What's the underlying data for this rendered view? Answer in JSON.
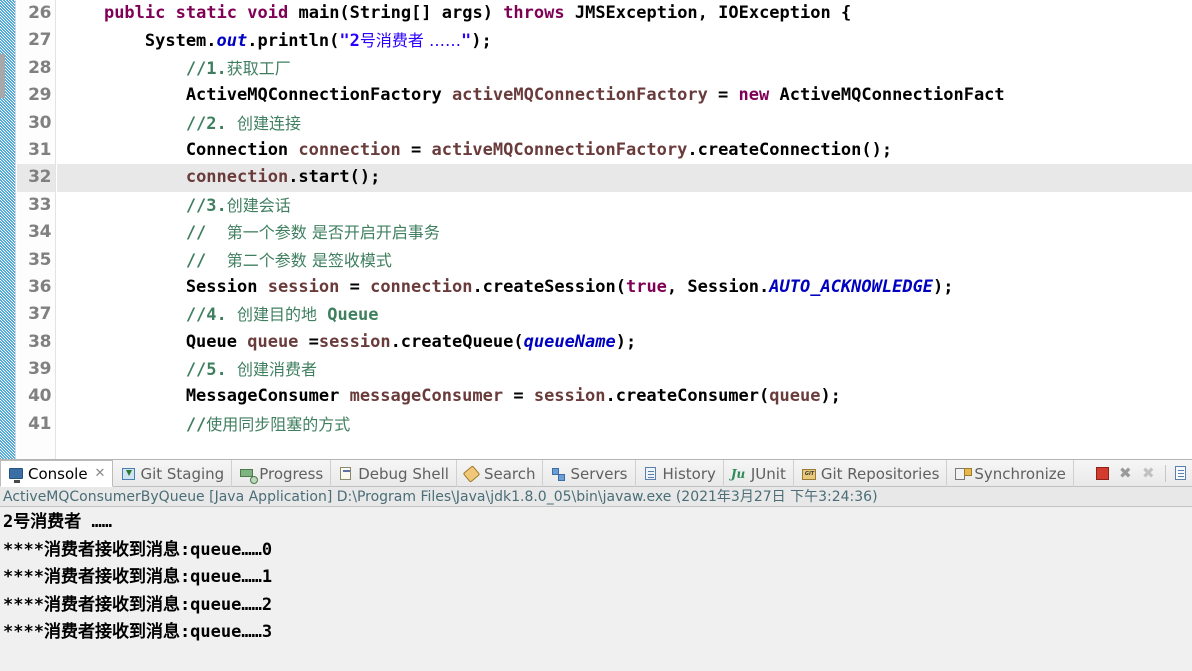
{
  "editor": {
    "lines": [
      {
        "no": "26",
        "folding": true,
        "highlight": false
      },
      {
        "no": "27",
        "folding": false,
        "highlight": false
      },
      {
        "no": "28",
        "folding": false,
        "highlight": false
      },
      {
        "no": "29",
        "folding": false,
        "highlight": false
      },
      {
        "no": "30",
        "folding": false,
        "highlight": false
      },
      {
        "no": "31",
        "folding": false,
        "highlight": false
      },
      {
        "no": "32",
        "folding": false,
        "highlight": true
      },
      {
        "no": "33",
        "folding": false,
        "highlight": false
      },
      {
        "no": "34",
        "folding": false,
        "highlight": false
      },
      {
        "no": "35",
        "folding": false,
        "highlight": false
      },
      {
        "no": "36",
        "folding": false,
        "highlight": false
      },
      {
        "no": "37",
        "folding": false,
        "highlight": false
      },
      {
        "no": "38",
        "folding": false,
        "highlight": false
      },
      {
        "no": "39",
        "folding": false,
        "highlight": false
      },
      {
        "no": "40",
        "folding": false,
        "highlight": false
      },
      {
        "no": "41",
        "folding": false,
        "highlight": false
      }
    ],
    "code_plain": [
      "    public static void main(String[] args) throws JMSException, IOException {",
      "        System.out.println(\"2号消费者 ……\");",
      "            //1.获取工厂",
      "            ActiveMQConnectionFactory activeMQConnectionFactory = new ActiveMQConnectionFact",
      "            //2. 创建连接",
      "            Connection connection = activeMQConnectionFactory.createConnection();",
      "            connection.start();",
      "            //3.创建会话",
      "            //  第一个参数 是否开启开启事务",
      "            //  第二个参数 是签收模式",
      "            Session session = connection.createSession(true, Session.AUTO_ACKNOWLEDGE);",
      "            //4. 创建目的地 Queue",
      "            Queue queue =session.createQueue(queueName);",
      "            //5. 创建消费者",
      "            MessageConsumer messageConsumer = session.createConsumer(queue);",
      "            //使用同步阻塞的方式"
    ],
    "colors": {
      "keyword": "#7f0055",
      "string": "#2a00ff",
      "comment": "#3f7f5f",
      "field": "#0000c0",
      "local": "#6a3b3b",
      "default": "#000000",
      "highlight_line": "#e8e8e8",
      "marker_bar": "#1a8fd1"
    }
  },
  "console_panel": {
    "tabs": [
      {
        "label": "Console",
        "icon": "console-icon",
        "active": true,
        "closable": true
      },
      {
        "label": "Git Staging",
        "icon": "git-staging-icon",
        "active": false,
        "closable": false
      },
      {
        "label": "Progress",
        "icon": "progress-icon",
        "active": false,
        "closable": false
      },
      {
        "label": "Debug Shell",
        "icon": "debug-shell-icon",
        "active": false,
        "closable": false
      },
      {
        "label": "Search",
        "icon": "search-icon",
        "active": false,
        "closable": false
      },
      {
        "label": "Servers",
        "icon": "servers-icon",
        "active": false,
        "closable": false
      },
      {
        "label": "History",
        "icon": "history-icon",
        "active": false,
        "closable": false
      },
      {
        "label": "JUnit",
        "icon": "junit-icon",
        "active": false,
        "closable": false
      },
      {
        "label": "Git Repositories",
        "icon": "git-repositories-icon",
        "active": false,
        "closable": false
      },
      {
        "label": "Synchronize",
        "icon": "synchronize-icon",
        "active": false,
        "closable": false
      }
    ],
    "close_glyph": "✕",
    "junit_glyph": "Ju",
    "toolbar": [
      {
        "name": "terminate-button",
        "icon": "stop-square-icon",
        "enabled": true
      },
      {
        "name": "remove-launch-button",
        "icon": "remove-x-icon",
        "enabled": true
      },
      {
        "name": "remove-all-launches-button",
        "icon": "remove-all-x-icon",
        "enabled": false
      },
      {
        "name": "clear-console-button",
        "icon": "clear-console-icon",
        "enabled": true
      },
      {
        "name": "scroll-lock-button",
        "icon": "scroll-lock-icon",
        "enabled": true
      },
      {
        "name": "word-wrap-button",
        "icon": "word-wrap-icon",
        "enabled": true
      },
      {
        "name": "pin-console-button",
        "icon": "pin-console-icon",
        "enabled": true
      }
    ],
    "status_line": "ActiveMQConsumerByQueue [Java Application] D:\\Program Files\\Java\\jdk1.8.0_05\\bin\\javaw.exe (2021年3月27日 下午3:24:36)",
    "output": [
      "2号消费者 ……",
      "****消费者接收到消息:queue……0",
      "****消费者接收到消息:queue……1",
      "****消费者接收到消息:queue……2",
      "****消费者接收到消息:queue……3"
    ]
  }
}
